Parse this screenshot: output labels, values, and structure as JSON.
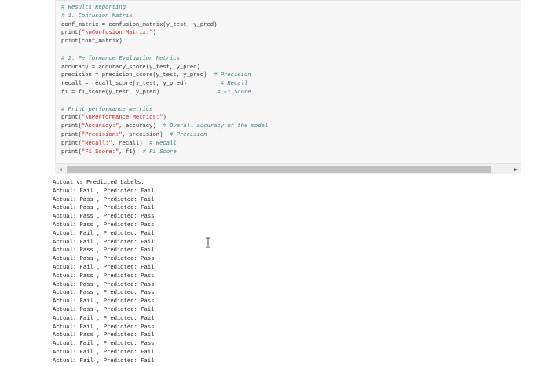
{
  "code_cell": {
    "lines": [
      [
        {
          "t": "# Results Reporting",
          "c": "cm"
        }
      ],
      [
        {
          "t": "# 1. Confusion Matrix",
          "c": "cm"
        }
      ],
      [
        {
          "t": "conf_matrix = confusion_matrix(y_test, y_pred)",
          "c": "pl"
        }
      ],
      [
        {
          "t": "print(",
          "c": "pl"
        },
        {
          "t": "\"\\nConfusion Matrix:\"",
          "c": "st"
        },
        {
          "t": ")",
          "c": "pl"
        }
      ],
      [
        {
          "t": "print(conf_matrix)",
          "c": "pl"
        }
      ],
      [
        {
          "t": "",
          "c": "pl"
        }
      ],
      [
        {
          "t": "# 2. Performance Evaluation Metrics",
          "c": "cm"
        }
      ],
      [
        {
          "t": "accuracy = accuracy_score(y_test, y_pred)",
          "c": "pl"
        }
      ],
      [
        {
          "t": "precision = precision_score(y_test, y_pred)  ",
          "c": "pl"
        },
        {
          "t": "# Precision",
          "c": "cm"
        }
      ],
      [
        {
          "t": "recall = recall_score(y_test, y_pred)          ",
          "c": "pl"
        },
        {
          "t": "# Recall",
          "c": "cm"
        }
      ],
      [
        {
          "t": "f1 = f1_score(y_test, y_pred)                 ",
          "c": "pl"
        },
        {
          "t": "# F1 Score",
          "c": "cm"
        }
      ],
      [
        {
          "t": "",
          "c": "pl"
        }
      ],
      [
        {
          "t": "# Print performance metrics",
          "c": "cm"
        }
      ],
      [
        {
          "t": "print(",
          "c": "pl"
        },
        {
          "t": "\"\\nPerformance Metrics:\"",
          "c": "st"
        },
        {
          "t": ")",
          "c": "pl"
        }
      ],
      [
        {
          "t": "print(",
          "c": "pl"
        },
        {
          "t": "\"Accuracy:\"",
          "c": "st"
        },
        {
          "t": ", accuracy)  ",
          "c": "pl"
        },
        {
          "t": "# Overall accuracy of the model",
          "c": "cm"
        }
      ],
      [
        {
          "t": "print(",
          "c": "pl"
        },
        {
          "t": "\"Precision:\"",
          "c": "st"
        },
        {
          "t": ", precision)  ",
          "c": "pl"
        },
        {
          "t": "# Precision",
          "c": "cm"
        }
      ],
      [
        {
          "t": "print(",
          "c": "pl"
        },
        {
          "t": "\"Recall:\"",
          "c": "st"
        },
        {
          "t": ", recall)  ",
          "c": "pl"
        },
        {
          "t": "# Recall",
          "c": "cm"
        }
      ],
      [
        {
          "t": "print(",
          "c": "pl"
        },
        {
          "t": "\"F1 Score:\"",
          "c": "st"
        },
        {
          "t": ", f1)  ",
          "c": "pl"
        },
        {
          "t": "# F1 Score",
          "c": "cm"
        }
      ]
    ]
  },
  "scrollbar": {
    "left_arrow": "◀",
    "right_arrow": "▶"
  },
  "output": {
    "header": "Actual vs Predicted Labels:",
    "rows": [
      [
        "Fail",
        "Fail"
      ],
      [
        "Pass",
        "Fail"
      ],
      [
        "Pass",
        "Fail"
      ],
      [
        "Pass",
        "Pass"
      ],
      [
        "Pass",
        "Pass"
      ],
      [
        "Fail",
        "Fail"
      ],
      [
        "Fail",
        "Fail"
      ],
      [
        "Pass",
        "Fail"
      ],
      [
        "Pass",
        "Pass"
      ],
      [
        "Fail",
        "Fail"
      ],
      [
        "Pass",
        "Pass"
      ],
      [
        "Pass",
        "Pass"
      ],
      [
        "Pass",
        "Pass"
      ],
      [
        "Fail",
        "Pass"
      ],
      [
        "Pass",
        "Fail"
      ],
      [
        "Fail",
        "Fail"
      ],
      [
        "Fail",
        "Pass"
      ],
      [
        "Pass",
        "Fail"
      ],
      [
        "Fail",
        "Pass"
      ],
      [
        "Fail",
        "Fail"
      ],
      [
        "Fail",
        "Fail"
      ]
    ],
    "actual_prefix": "Actual: ",
    "predicted_prefix": " , Predicted: "
  },
  "cursor": {
    "icon": "text-cursor-icon"
  }
}
